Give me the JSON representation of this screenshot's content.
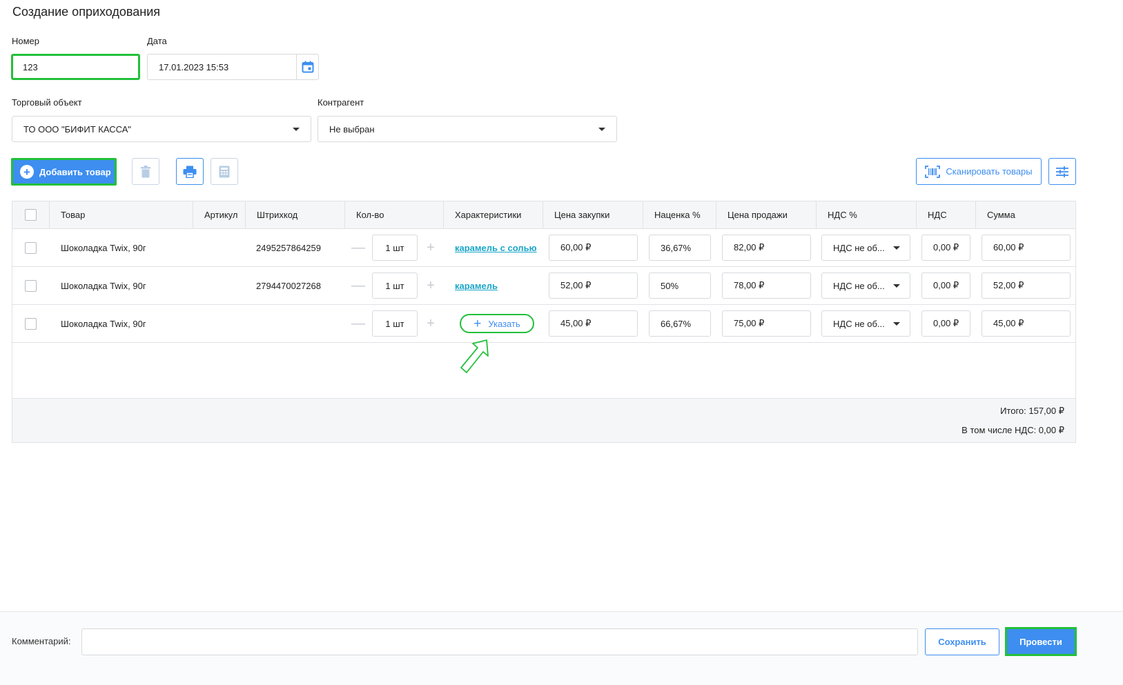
{
  "page": {
    "title": "Создание оприходования"
  },
  "form": {
    "number_label": "Номер",
    "number_value": "123",
    "date_label": "Дата",
    "date_value": "17.01.2023 15:53",
    "store_label": "Торговый объект",
    "store_value": "ТО ООО \"БИФИТ КАССА\"",
    "counterparty_label": "Контрагент",
    "counterparty_value": "Не выбран"
  },
  "toolbar": {
    "add_label": "Добавить товар",
    "scan_label": "Сканировать товары"
  },
  "table": {
    "headers": [
      "Товар",
      "Артикул",
      "Штрихкод",
      "Кол-во",
      "Характеристики",
      "Цена закупки",
      "Наценка %",
      "Цена продажи",
      "НДС %",
      "НДС",
      "Сумма"
    ],
    "rows": [
      {
        "name": "Шоколадка Twix, 90г",
        "article": "",
        "barcode": "2495257864259",
        "qty": "1 шт",
        "characteristic": "карамель с солью",
        "purchase_price": "60,00 ₽",
        "markup": "36,67%",
        "sale_price": "82,00 ₽",
        "vat_rate": "НДС не об...",
        "vat": "0,00 ₽",
        "sum": "60,00 ₽"
      },
      {
        "name": "Шоколадка Twix, 90г",
        "article": "",
        "barcode": "2794470027268",
        "qty": "1 шт",
        "characteristic": "карамель",
        "purchase_price": "52,00 ₽",
        "markup": "50%",
        "sale_price": "78,00 ₽",
        "vat_rate": "НДС не об...",
        "vat": "0,00 ₽",
        "sum": "52,00 ₽"
      },
      {
        "name": "Шоколадка Twix, 90г",
        "article": "",
        "barcode": "",
        "qty": "1 шт",
        "characteristic_button": "Указать",
        "purchase_price": "45,00 ₽",
        "markup": "66,67%",
        "sale_price": "75,00 ₽",
        "vat_rate": "НДС не об...",
        "vat": "0,00 ₽",
        "sum": "45,00 ₽"
      }
    ],
    "total": "Итого: 157,00 ₽",
    "total_vat": "В том числе НДС: 0,00 ₽"
  },
  "footer": {
    "comment_label": "Комментарий:",
    "comment_value": "",
    "save_label": "Сохранить",
    "post_label": "Провести"
  },
  "colors": {
    "accent": "#3d8ef0",
    "highlight": "#22c03a",
    "link": "#1aa6c9"
  },
  "icons": [
    "calendar-icon",
    "chevron-down-icon",
    "plus-circle-icon",
    "trash-icon",
    "print-icon",
    "calculator-icon",
    "barcode-icon",
    "settings-sliders-icon",
    "minus-icon",
    "plus-icon",
    "arrow-pointer-icon"
  ]
}
